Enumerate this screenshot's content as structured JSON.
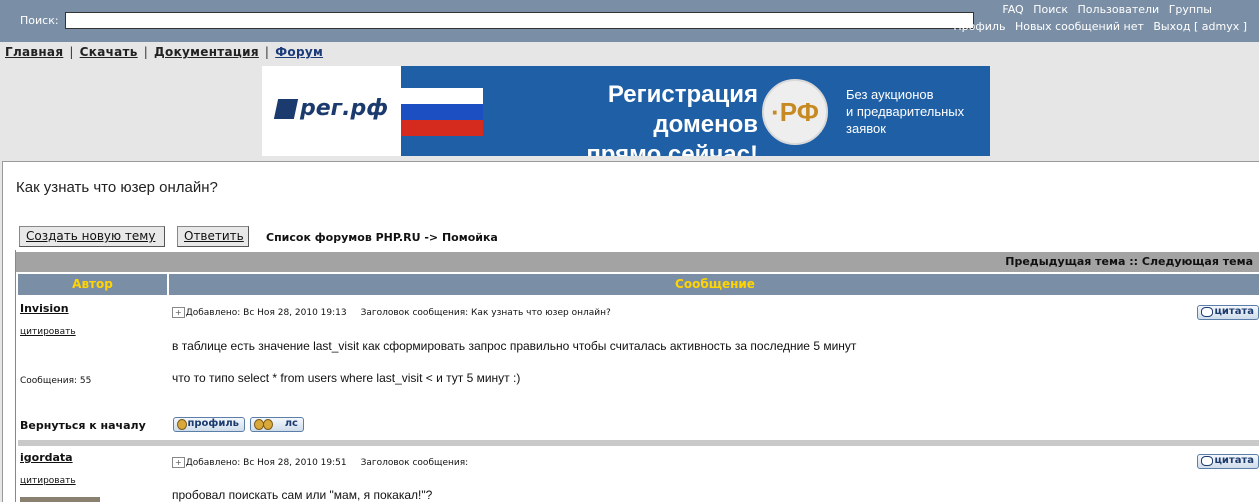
{
  "topbar": {
    "search_label": "Поиск:",
    "search_value": "",
    "links_row1": [
      "FAQ",
      "Поиск",
      "Пользователи",
      "Группы"
    ],
    "links_row2": [
      "Профиль",
      "Новых сообщений нет",
      "Выход [ admyx ]"
    ]
  },
  "nav": {
    "items": [
      "Главная",
      "Скачать",
      "Документация",
      "Форум"
    ]
  },
  "banner": {
    "logo": "рег.рф",
    "headline_line1": "Регистрация доменов",
    "headline_line2": "прямо сейчас!",
    "badge": "·РФ",
    "side_line1": "Без аукционов",
    "side_line2": "и предварительных",
    "side_line3": "заявок"
  },
  "topic": {
    "title": "Как узнать что юзер онлайн?",
    "new_topic_label": "Создать новую тему",
    "reply_label": "Ответить",
    "breadcrumb": "Список форумов PHP.RU -> Помойка"
  },
  "table": {
    "prev_topic": "Предыдущая тема",
    "sep": "::",
    "next_topic": "Следующая тема",
    "col_author": "Автор",
    "col_message": "Сообщение"
  },
  "posts": [
    {
      "author": "Invision",
      "quote_link": "цитировать",
      "plus": "+",
      "added": "Добавлено: Вс Ноя 28, 2010 19:13",
      "subject": "Заголовок сообщения: Как узнать что юзер онлайн?",
      "cite_label": "цитата",
      "line1": "в таблице есть значение last_visit как сформировать запрос правильно чтобы считалась активность за последние 5 минут",
      "line2": "что то типо select * from users where last_visit < и тут 5 минут :)",
      "msg_count": "Сообщения: 55",
      "back_to_top": "Вернуться к началу",
      "profile_label": "профиль",
      "pm_label": "лс"
    },
    {
      "author": "igordata",
      "quote_link": "цитировать",
      "plus": "+",
      "added": "Добавлено: Вс Ноя 28, 2010 19:51",
      "subject": "Заголовок сообщения:",
      "cite_label": "цитата",
      "line1": "пробовал поискать сам или \"мам, я покакал!\"?"
    }
  ],
  "colors": {
    "topbar": "#7a8fa6",
    "header_text": "#ffd400",
    "banner_blue": "#1f5fa6"
  }
}
